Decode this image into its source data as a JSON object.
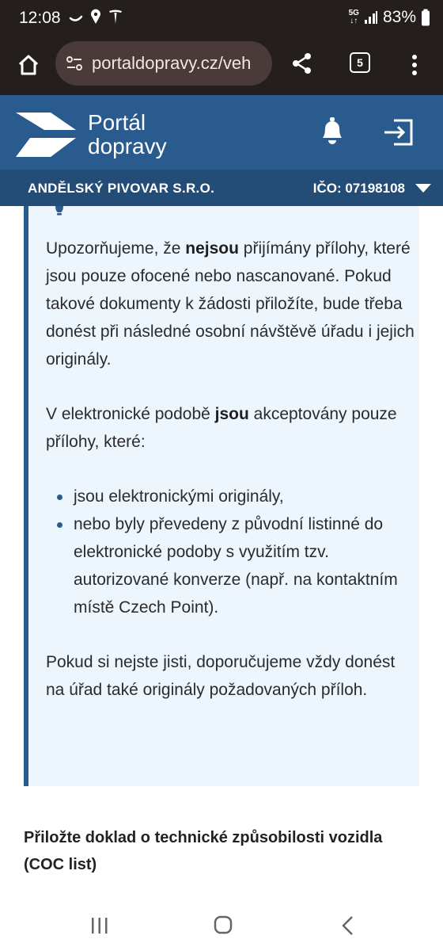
{
  "status_bar": {
    "time": "12:08",
    "network": "5G",
    "battery": "83%"
  },
  "browser": {
    "url": "portaldopravy.cz/veh",
    "tab_count": "5"
  },
  "site": {
    "logo_line1": "Portál",
    "logo_line2": "dopravy"
  },
  "company": {
    "name": "ANDĚLSKÝ PIVOVAR S.R.O.",
    "ico": "IČO: 07198108"
  },
  "notice": {
    "p1_before": "Upozorňujeme, že ",
    "p1_bold": "nejsou",
    "p1_after": " přijímány přílohy, které jsou pouze ofocené nebo nascanované. Pokud takové dokumenty k žádosti přiložíte, bude třeba donést při následné osobní návštěvě úřadu i jejich originály.",
    "p2_before": "V elektronické podobě ",
    "p2_bold": "jsou",
    "p2_after": " akceptovány pouze přílohy, které:",
    "list": [
      "jsou elektronickými originály,",
      "nebo byly převedeny z původní listinné do elektronické podoby s využitím tzv. autorizované konverze (např. na kontaktním místě Czech Point)."
    ],
    "p3": "Pokud si nejste jisti, doporučujeme vždy donést na úřad také originály požadovaných příloh."
  },
  "section": {
    "title": "Přiložte doklad o technické způsobilosti vozidla (COC list)"
  },
  "colors": {
    "header_blue": "#2a5b8f",
    "company_bar_blue": "#234c77",
    "notice_bg": "#eef6fd",
    "browser_bg": "#241e1d"
  }
}
